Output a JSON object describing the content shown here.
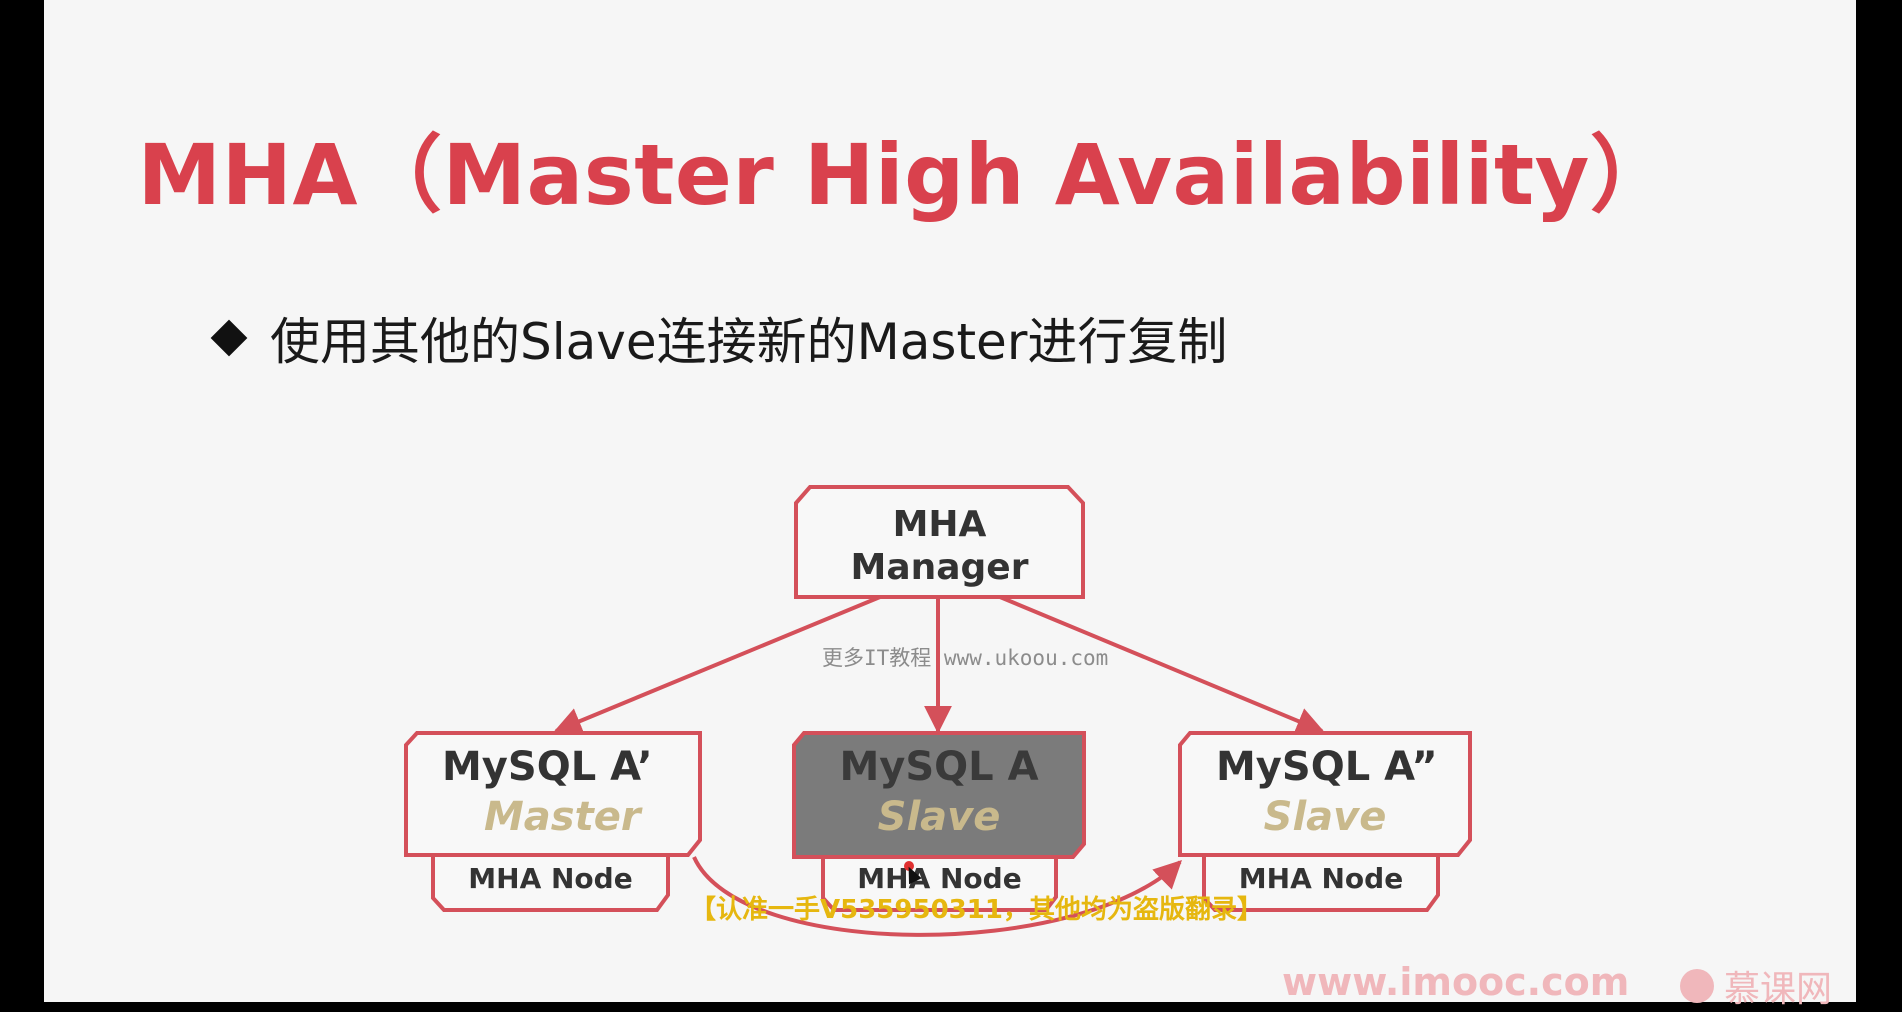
{
  "slide": {
    "title": "MHA（Master High Availability）",
    "bullet": "使用其他的Slave连接新的Master进行复制"
  },
  "diagram": {
    "manager": {
      "line1": "MHA",
      "line2": "Manager"
    },
    "nodes": [
      {
        "name": "MySQL A’",
        "role": "Master",
        "node_label": "MHA Node",
        "highlighted": false
      },
      {
        "name": "MySQL A",
        "role": "Slave",
        "node_label": "MHA Node",
        "highlighted": true
      },
      {
        "name": "MySQL A”",
        "role": "Slave",
        "node_label": "MHA Node",
        "highlighted": false
      }
    ]
  },
  "overlays": {
    "watermark_center": "更多IT教程 www.ukoou.com",
    "watermark_caption": "【认准一手V535950311，其他均为盗版翻录】"
  },
  "footer": {
    "url": "www.imooc.com",
    "brand": "慕课网"
  },
  "colors": {
    "title_red": "#d9414d",
    "box_border": "#d4505a",
    "role_gold": "#c9b98c",
    "highlight_gray": "#7b7b7b"
  }
}
